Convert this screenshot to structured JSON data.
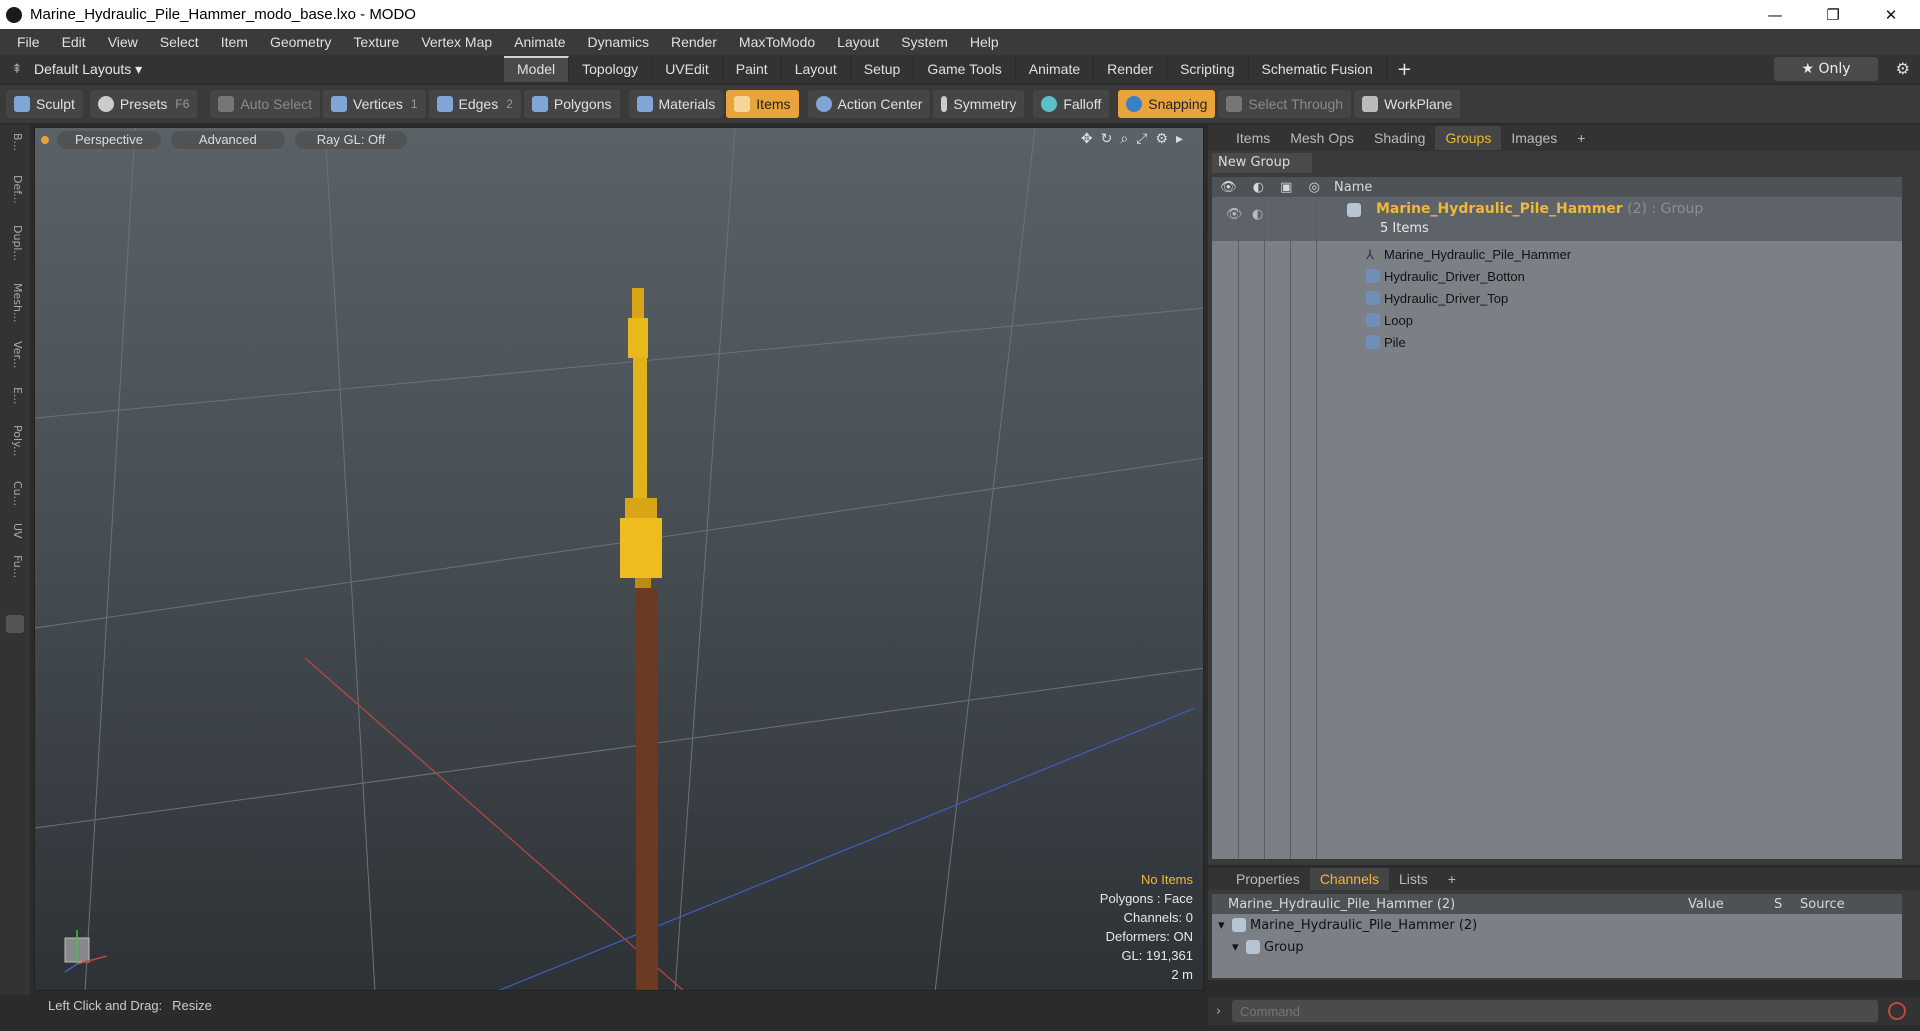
{
  "window": {
    "title": "Marine_Hydraulic_Pile_Hammer_modo_base.lxo - MODO",
    "minimize": "—",
    "maximize": "❐",
    "close": "✕"
  },
  "menu": [
    "File",
    "Edit",
    "View",
    "Select",
    "Item",
    "Geometry",
    "Texture",
    "Vertex Map",
    "Animate",
    "Dynamics",
    "Render",
    "MaxToModo",
    "Layout",
    "System",
    "Help"
  ],
  "layout": {
    "selector": "Default Layouts ▾",
    "tabs": [
      "Model",
      "Topology",
      "UVEdit",
      "Paint",
      "Layout",
      "Setup",
      "Game Tools",
      "Animate",
      "Render",
      "Scripting",
      "Schematic Fusion"
    ],
    "active_tab": "Model",
    "plus": "+",
    "only": "★ Only"
  },
  "toolbar": {
    "sculpt": "Sculpt",
    "presets": "Presets",
    "presets_key": "F6",
    "auto_select": "Auto Select",
    "vertices": "Vertices",
    "vertices_num": "1",
    "edges": "Edges",
    "edges_num": "2",
    "polygons": "Polygons",
    "materials": "Materials",
    "items": "Items",
    "action_center": "Action Center",
    "symmetry": "Symmetry",
    "falloff": "Falloff",
    "snapping": "Snapping",
    "select_through": "Select Through",
    "workplane": "WorkPlane"
  },
  "leftstrip": [
    "B...",
    "Def...",
    "Dupl...",
    "Mesh...",
    "Ver...",
    "E...",
    "Poly...",
    "Cu...",
    "UV",
    "Fu..."
  ],
  "viewport": {
    "perspective": "Perspective",
    "advanced": "Advanced",
    "raygl": "Ray GL: Off",
    "info": {
      "no_items": "No Items",
      "polygons": "Polygons : Face",
      "channels": "Channels: 0",
      "deformers": "Deformers: ON",
      "gl": "GL: 191,361",
      "scale": "2 m"
    }
  },
  "status": {
    "hint": "Left Click and Drag:",
    "action": "Resize"
  },
  "rightpanel": {
    "tabs": [
      "Items",
      "Mesh Ops",
      "Shading",
      "Groups",
      "Images"
    ],
    "active_tab": "Groups",
    "plus": "+",
    "new_group": "New Group",
    "name_header": "Name",
    "group": {
      "name": "Marine_Hydraulic_Pile_Hammer",
      "suffix": " (2) : Group",
      "count": "5 Items"
    },
    "items": [
      "Marine_Hydraulic_Pile_Hammer",
      "Hydraulic_Driver_Botton",
      "Hydraulic_Driver_Top",
      "Loop",
      "Pile"
    ]
  },
  "channels": {
    "tabs": [
      "Properties",
      "Channels",
      "Lists"
    ],
    "active_tab": "Channels",
    "plus": "+",
    "headers": {
      "name": "Marine_Hydraulic_Pile_Hammer (2)",
      "value": "Value",
      "s": "S",
      "source": "Source"
    },
    "rows": [
      "Marine_Hydraulic_Pile_Hammer (2)",
      "Group"
    ]
  },
  "command": {
    "placeholder": "Command"
  }
}
